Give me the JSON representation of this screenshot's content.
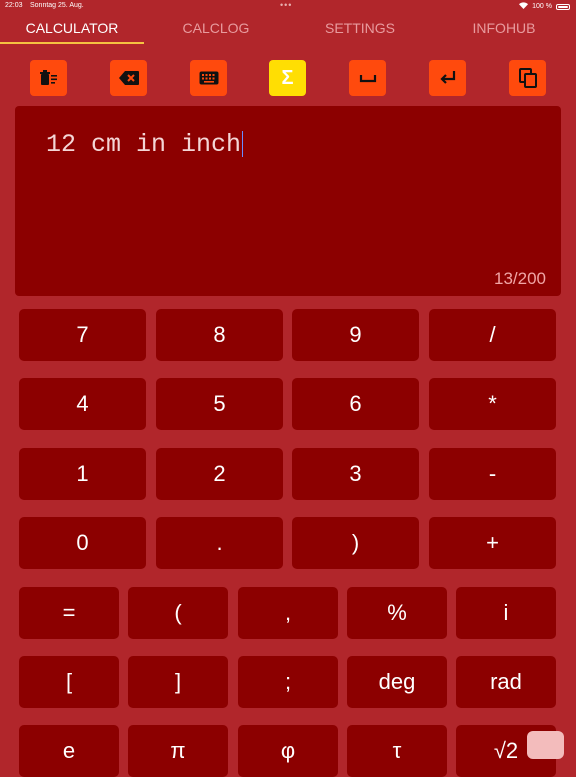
{
  "status_bar": {
    "time": "22:03",
    "date": "Sonntag 25. Aug.",
    "battery": "100 %"
  },
  "tabs": [
    {
      "label": "CALCULATOR",
      "active": true
    },
    {
      "label": "CALCLOG",
      "active": false
    },
    {
      "label": "SETTINGS",
      "active": false
    },
    {
      "label": "INFOHUB",
      "active": false
    }
  ],
  "toolbar": {
    "icons": [
      "clear-all-icon",
      "backspace-icon",
      "keyboard-icon",
      "sigma-icon",
      "space-icon",
      "return-icon",
      "copy-icon"
    ],
    "sigma_symbol": "Σ"
  },
  "display": {
    "expression": "12 cm in inch",
    "counter": "13/200"
  },
  "keys": {
    "row1": [
      "7",
      "8",
      "9",
      "/"
    ],
    "row2": [
      "4",
      "5",
      "6",
      "*"
    ],
    "row3": [
      "1",
      "2",
      "3",
      "-"
    ],
    "row4": [
      "0",
      ".",
      ")",
      "+"
    ],
    "row5": [
      "=",
      "(",
      ",",
      "%",
      "i"
    ],
    "row6": [
      "[",
      "]",
      ";",
      "deg",
      "rad"
    ],
    "row7": [
      "e",
      "π",
      "φ",
      "τ",
      "√2"
    ]
  },
  "colors": {
    "background": "#b1262b",
    "panel": "#8c0000",
    "tool": "#ff4a0d",
    "sigma": "#ffde03",
    "tab_indicator": "#f5c242"
  }
}
